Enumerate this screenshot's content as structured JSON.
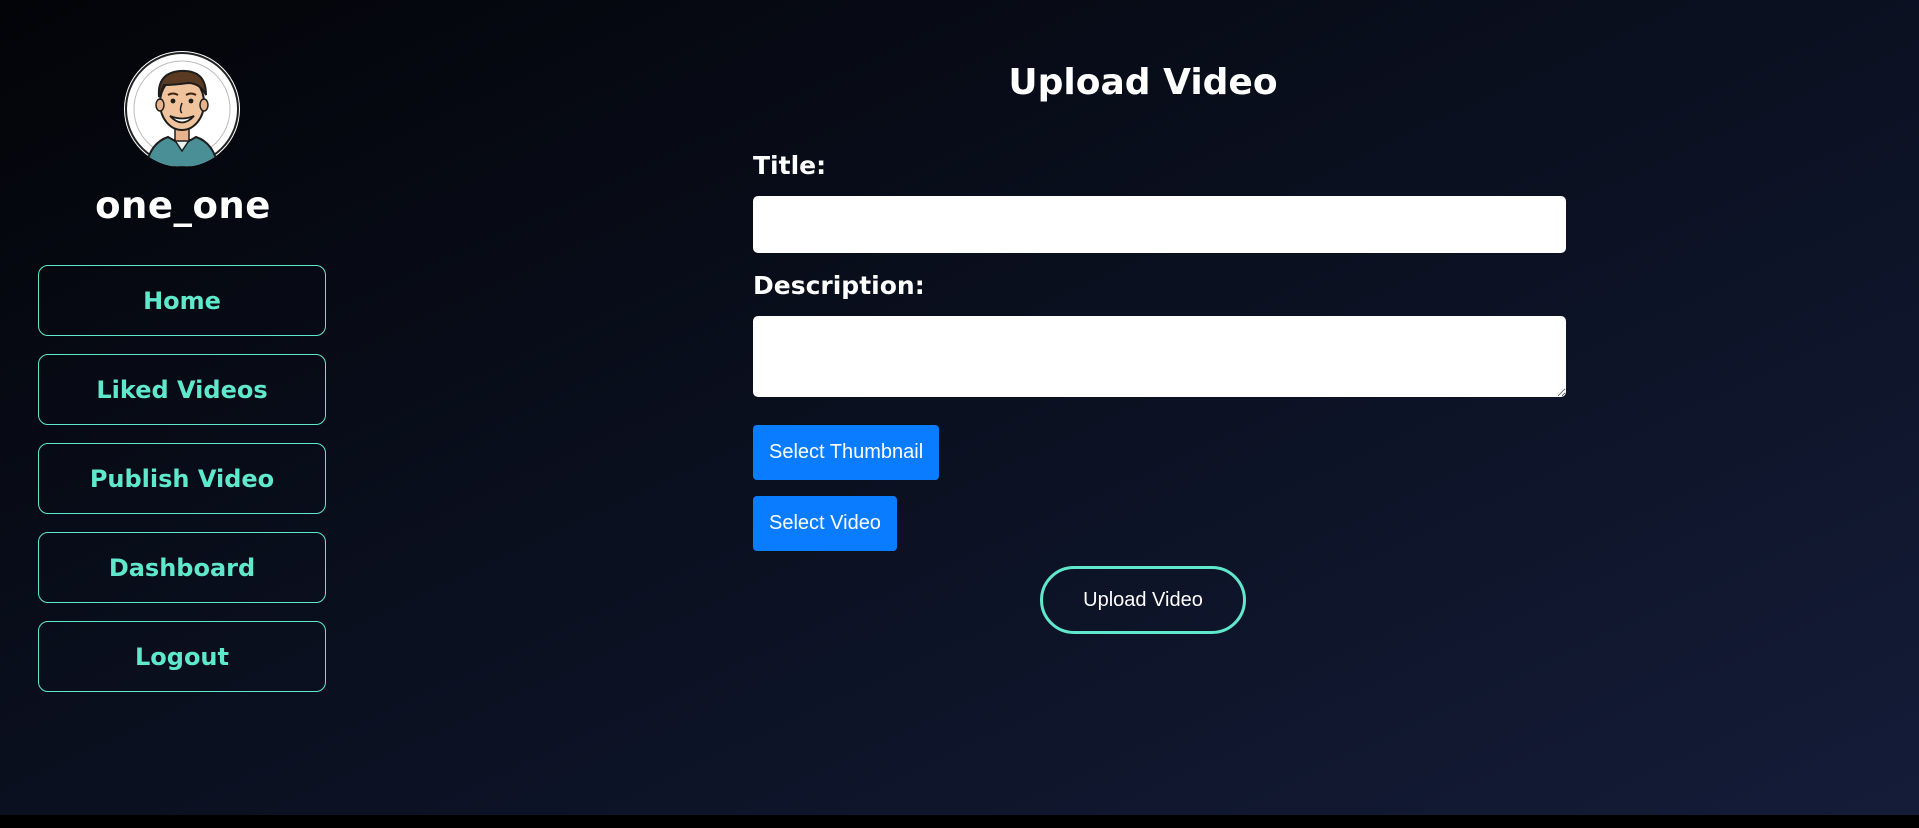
{
  "sidebar": {
    "username": "one_one",
    "avatar_icon": "avatar-icon",
    "items": [
      {
        "label": "Home"
      },
      {
        "label": "Liked Videos"
      },
      {
        "label": "Publish Video"
      },
      {
        "label": "Dashboard"
      },
      {
        "label": "Logout"
      }
    ]
  },
  "form": {
    "title": "Upload Video",
    "title_label": "Title:",
    "title_value": "",
    "description_label": "Description:",
    "description_value": "",
    "select_thumbnail_label": "Select Thumbnail",
    "select_video_label": "Select Video",
    "upload_label": "Upload Video"
  },
  "colors": {
    "accent": "#5fe8cc",
    "primary_button": "#0a7cff",
    "background_dark": "#030408",
    "background_light": "#141c38"
  }
}
